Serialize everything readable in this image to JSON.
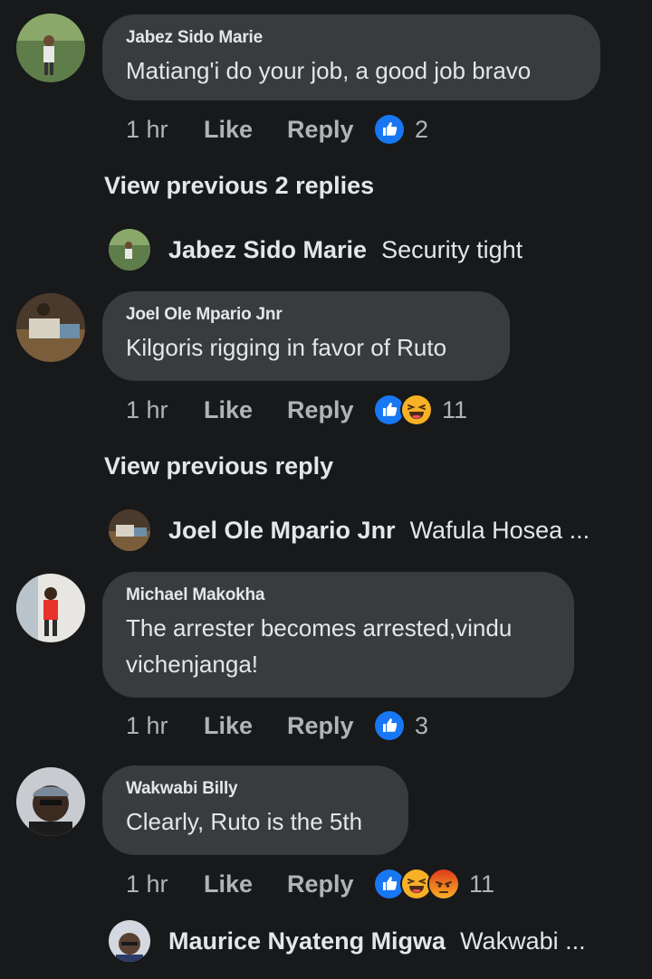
{
  "colors": {
    "background": "#18191a",
    "bubble": "#3a3b3c",
    "text": "#e4e6eb",
    "meta": "#b0b3b8",
    "like_blue": "#1877f2",
    "haha_yellow": "#f7b125",
    "angry_orange": "#e9710f"
  },
  "comments": [
    {
      "author": "Jabez Sido Marie",
      "text": "Matiang'i do your job, a good job bravo",
      "time": "1 hr",
      "like_label": "Like",
      "reply_label": "Reply",
      "reactions": [
        "like-icon"
      ],
      "reaction_count": "2",
      "view_previous": "View previous 2 replies",
      "reply_preview": {
        "author": "Jabez Sido Marie",
        "text": "Security tight"
      }
    },
    {
      "author": "Joel Ole Mpario Jnr",
      "text": "Kilgoris rigging in favor of Ruto",
      "time": "1 hr",
      "like_label": "Like",
      "reply_label": "Reply",
      "reactions": [
        "like-icon",
        "haha-icon"
      ],
      "reaction_count": "11",
      "view_previous": "View previous reply",
      "reply_preview": {
        "author": "Joel Ole Mpario Jnr",
        "text": "Wafula Hosea ..."
      }
    },
    {
      "author": "Michael Makokha",
      "text_line1": "The arrester becomes arrested,vindu",
      "text_line2": "vichenjanga!",
      "time": "1 hr",
      "like_label": "Like",
      "reply_label": "Reply",
      "reactions": [
        "like-icon"
      ],
      "reaction_count": "3"
    },
    {
      "author": "Wakwabi Billy",
      "text": "Clearly, Ruto is the 5th",
      "time": "1 hr",
      "like_label": "Like",
      "reply_label": "Reply",
      "reactions": [
        "like-icon",
        "haha-icon",
        "angry-icon"
      ],
      "reaction_count": "11",
      "reply_preview": {
        "author": "Maurice Nyateng Migwa",
        "text": "Wakwabi ..."
      }
    }
  ]
}
